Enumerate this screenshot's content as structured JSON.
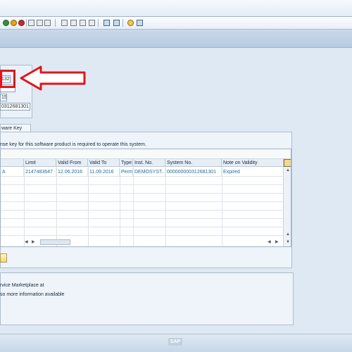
{
  "form": {
    "value1": "132",
    "value3": "15",
    "value4": "0312681301"
  },
  "tab_label": "ware Key",
  "description": "nse key for this software product is required to operate this system.",
  "grid": {
    "columns": [
      "Limit",
      "Valid From",
      "Valid To",
      "Type",
      "Inst. No.",
      "System No.",
      "Note on Validity"
    ],
    "rows": [
      {
        "first": "A",
        "limit": "2147483647",
        "valid_from": "12.06.2016",
        "valid_to": "11.09.2016",
        "type": "Perm",
        "inst_no": "DEMOSYST...",
        "system_no": "000000000312681301",
        "note": "Expired"
      }
    ]
  },
  "info": {
    "line1": "rvice Marketplace at",
    "line2": "so more information available"
  },
  "brand": "SAP",
  "colors": {
    "highlight": "#e0151b",
    "link_text": "#1f6f9f"
  }
}
